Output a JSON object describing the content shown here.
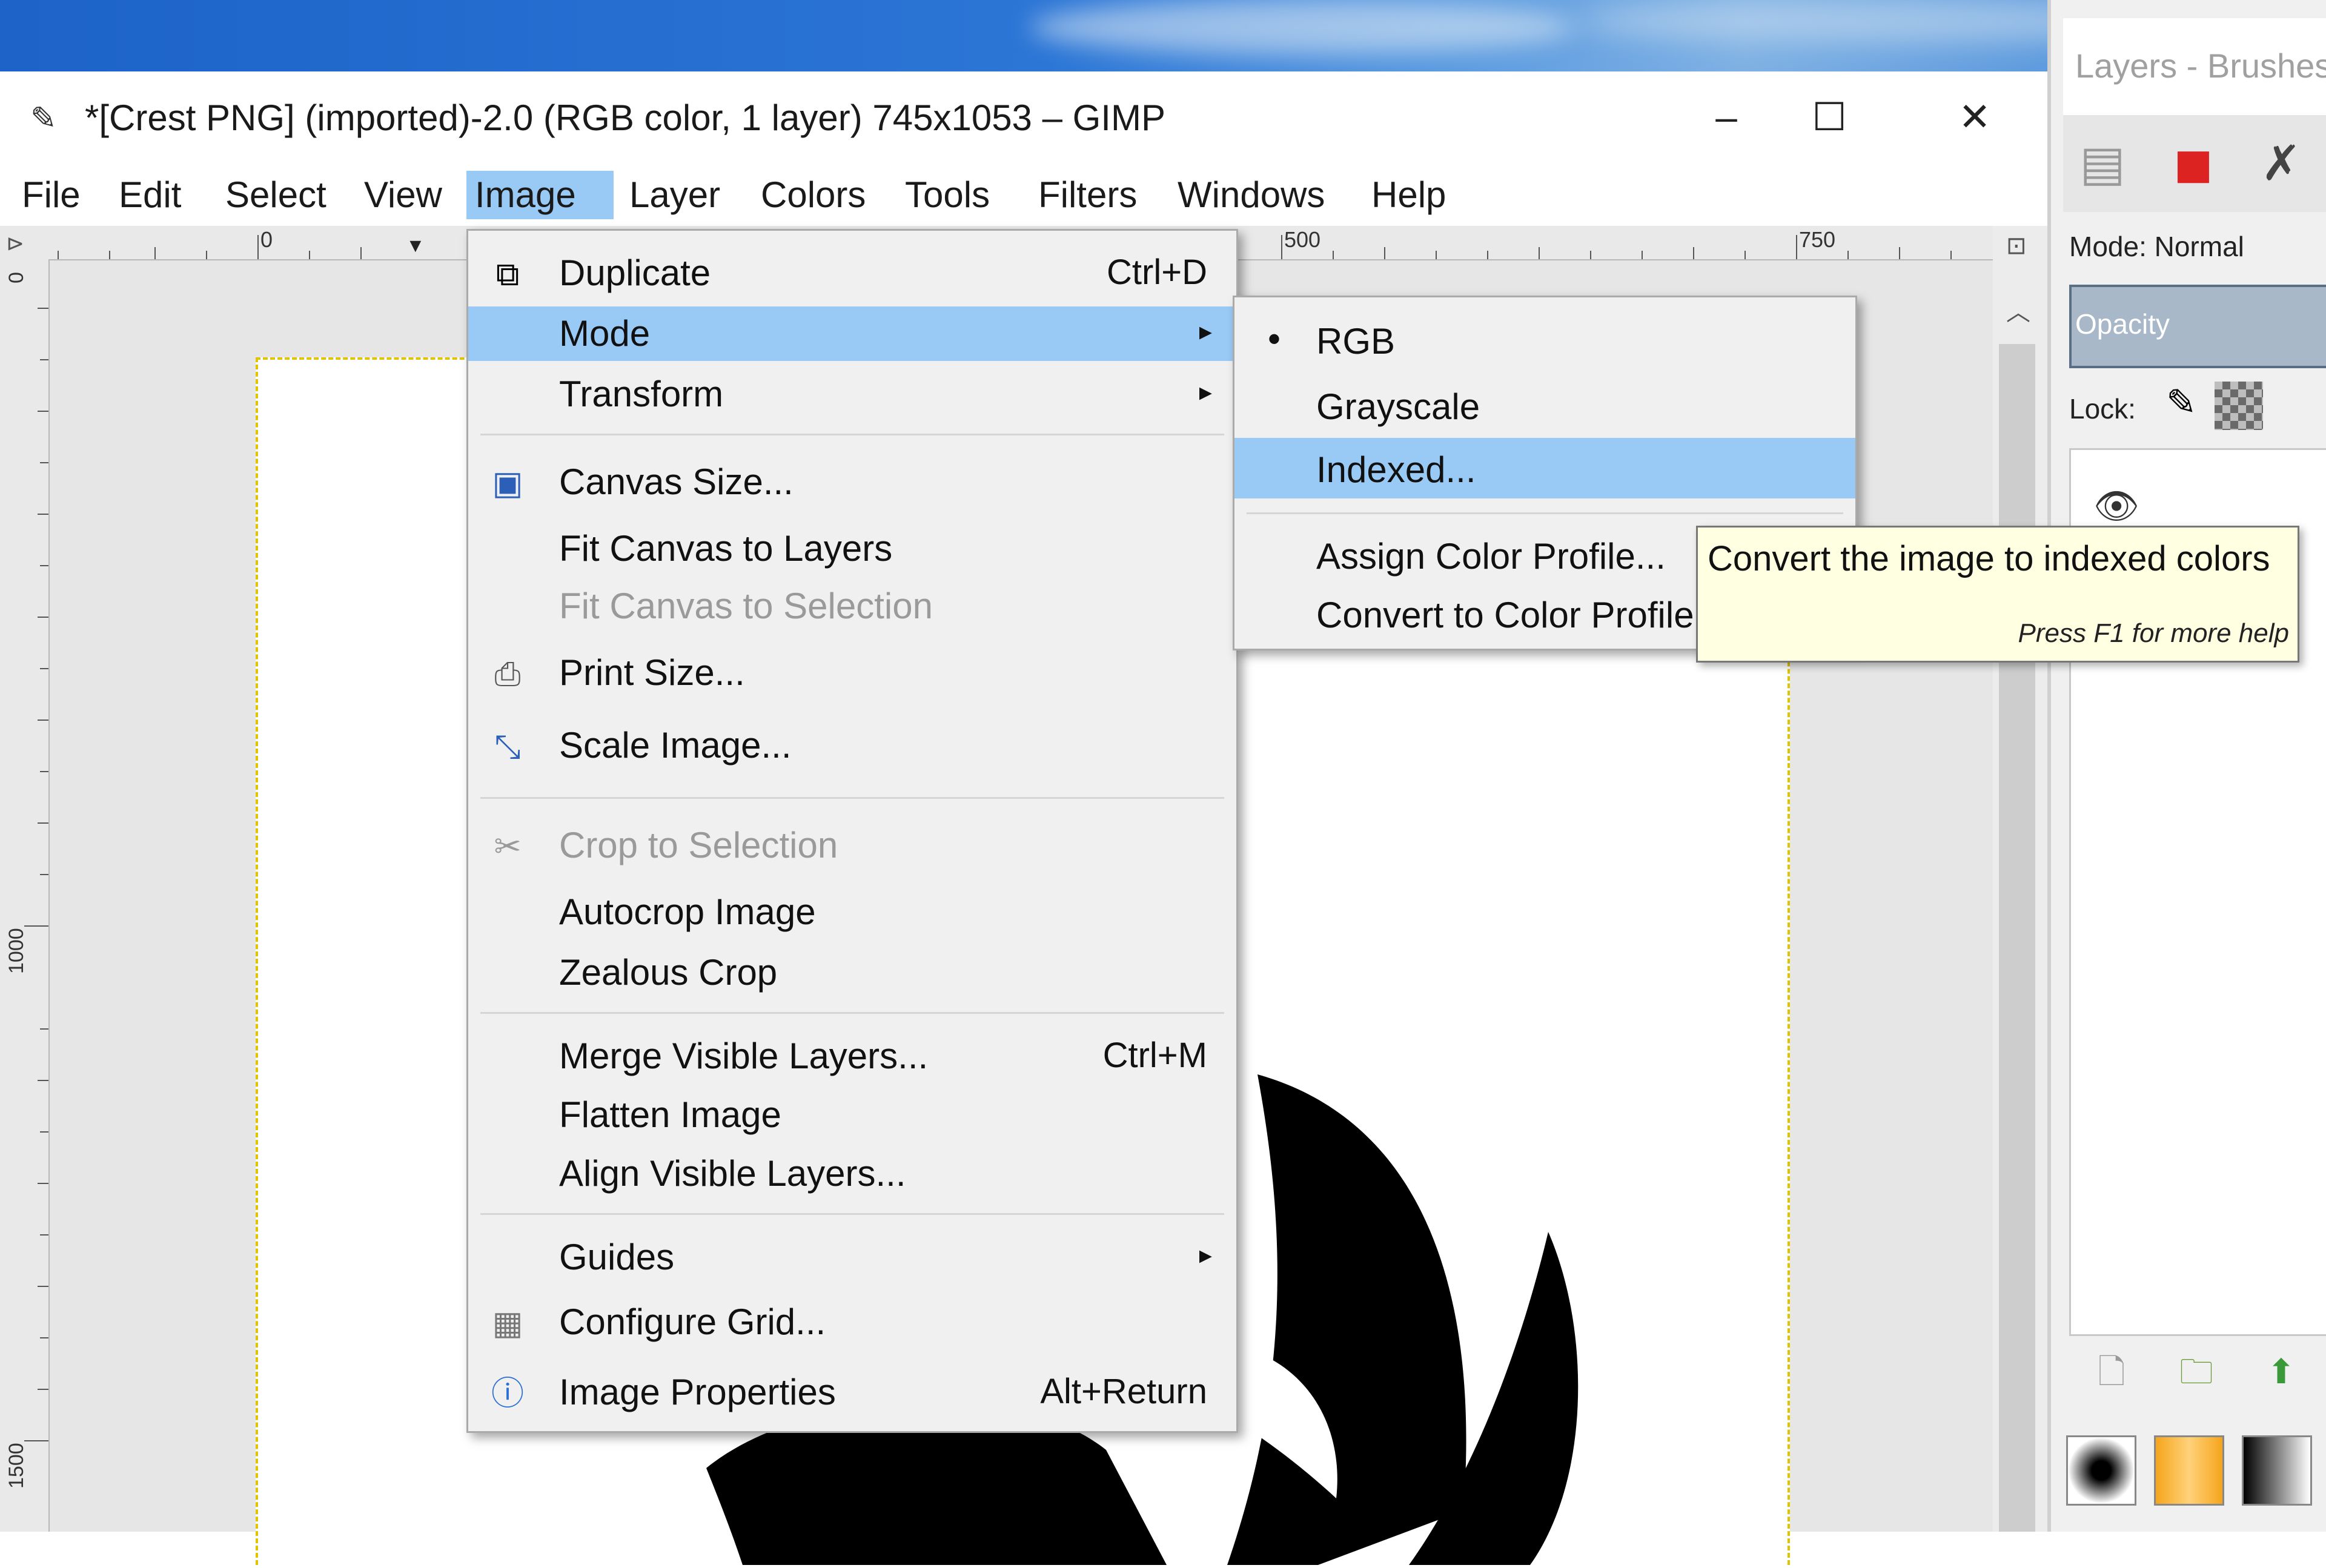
{
  "window": {
    "title": "*[Crest PNG] (imported)-2.0 (RGB color, 1 layer) 745x1053 – GIMP",
    "minimize_label": "–",
    "maximize_label": "☐",
    "close_label": "✕"
  },
  "menubar": {
    "items": [
      "File",
      "Edit",
      "Select",
      "View",
      "Image",
      "Layer",
      "Colors",
      "Tools",
      "Filters",
      "Windows",
      "Help"
    ],
    "active": "Image"
  },
  "ruler": {
    "top_labels": [
      "0",
      "500",
      "750"
    ],
    "left_labels": [
      "0",
      "1000",
      "1500"
    ]
  },
  "image_menu": {
    "items": [
      {
        "label": "Duplicate",
        "shortcut": "Ctrl+D",
        "icon": "duplicate-icon"
      },
      {
        "label": "Mode",
        "submenu": true,
        "highlighted": true
      },
      {
        "label": "Transform",
        "submenu": true
      },
      {
        "label": "Canvas Size...",
        "icon": "canvas-size-icon"
      },
      {
        "label": "Fit Canvas to Layers"
      },
      {
        "label": "Fit Canvas to Selection",
        "disabled": true
      },
      {
        "label": "Print Size...",
        "icon": "print-size-icon"
      },
      {
        "label": "Scale Image...",
        "icon": "scale-image-icon"
      },
      {
        "label": "Crop to Selection",
        "disabled": true,
        "icon": "crop-icon"
      },
      {
        "label": "Autocrop Image"
      },
      {
        "label": "Zealous Crop"
      },
      {
        "label": "Merge Visible Layers...",
        "shortcut": "Ctrl+M"
      },
      {
        "label": "Flatten Image"
      },
      {
        "label": "Align Visible Layers..."
      },
      {
        "label": "Guides",
        "submenu": true
      },
      {
        "label": "Configure Grid...",
        "icon": "grid-icon"
      },
      {
        "label": "Image Properties",
        "shortcut": "Alt+Return",
        "icon": "info-icon"
      }
    ]
  },
  "mode_submenu": {
    "items": [
      {
        "label": "RGB",
        "selected": true
      },
      {
        "label": "Grayscale"
      },
      {
        "label": "Indexed...",
        "highlighted": true
      },
      {
        "label": "Assign Color Profile..."
      },
      {
        "label": "Convert to Color Profile..."
      }
    ]
  },
  "tooltip": {
    "text": "Convert the image to indexed colors",
    "hint": "Press F1 for more help"
  },
  "dock": {
    "title": "Layers - Brushes",
    "mode_label": "Mode: Normal",
    "opacity_label": "Opacity",
    "lock_label": "Lock:",
    "tabs": [
      "layers-tab-icon",
      "channels-tab-icon",
      "paths-tab-icon"
    ]
  },
  "colors": {
    "menu_highlight": "#99c9f5",
    "menu_bg": "#f0f0f0",
    "tooltip_bg": "#ffffe1",
    "selection_border": "#e0c400"
  }
}
